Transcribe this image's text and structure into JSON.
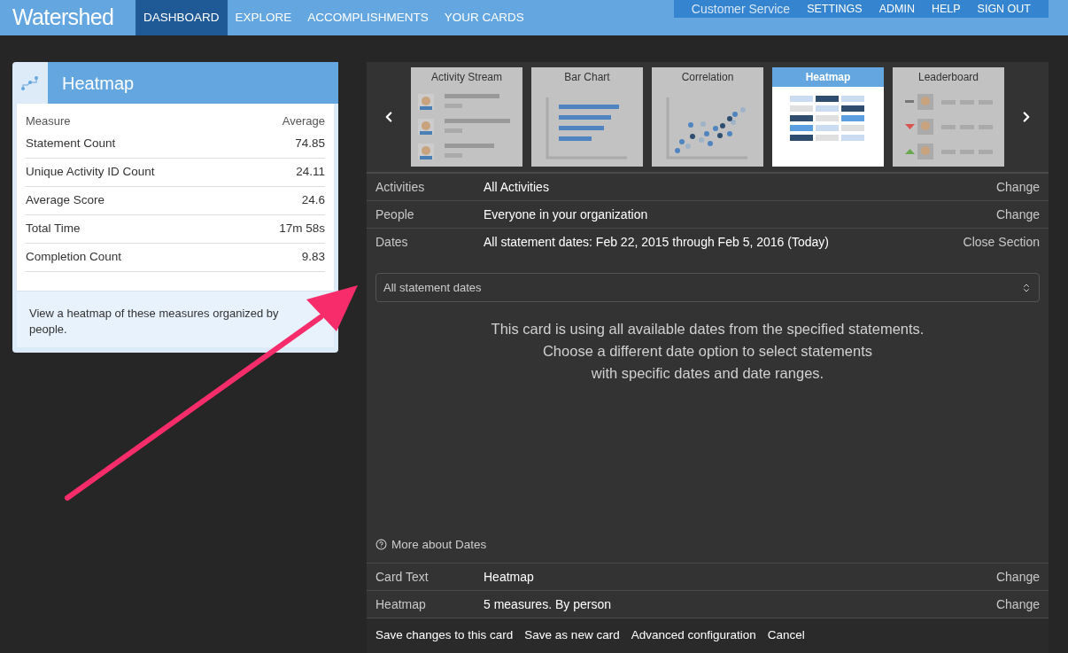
{
  "nav": {
    "logo": "Watershed",
    "items": [
      {
        "label": "DASHBOARD",
        "selected": true
      },
      {
        "label": "EXPLORE",
        "selected": false
      },
      {
        "label": "ACCOMPLISHMENTS",
        "selected": false
      },
      {
        "label": "YOUR CARDS",
        "selected": false
      }
    ],
    "account": "Customer Service",
    "links": [
      "SETTINGS",
      "ADMIN",
      "HELP",
      "SIGN OUT"
    ]
  },
  "card": {
    "title": "Heatmap",
    "columns": [
      "Measure",
      "Average"
    ],
    "rows": [
      {
        "measure": "Statement Count",
        "average": "74.85"
      },
      {
        "measure": "Unique Activity ID Count",
        "average": "24.11"
      },
      {
        "measure": "Average Score",
        "average": "24.6"
      },
      {
        "measure": "Total Time",
        "average": "17m 58s"
      },
      {
        "measure": "Completion Count",
        "average": "9.83"
      }
    ],
    "description": "View a heatmap of these measures organized by people."
  },
  "gallery": [
    {
      "label": "Activity Stream",
      "kind": "stream",
      "selected": false
    },
    {
      "label": "Bar Chart",
      "kind": "bar",
      "selected": false
    },
    {
      "label": "Correlation",
      "kind": "scatter",
      "selected": false
    },
    {
      "label": "Heatmap",
      "kind": "heatmap",
      "selected": true
    },
    {
      "label": "Leaderboard",
      "kind": "leaderboard",
      "selected": false
    }
  ],
  "settings": [
    {
      "label": "Activities",
      "value": "All Activities",
      "action": "Change"
    },
    {
      "label": "People",
      "value": "Everyone in your organization",
      "action": "Change"
    },
    {
      "label": "Dates",
      "value": "All statement dates: Feb 22, 2015 through Feb 5, 2016 (Today)",
      "action": "Close Section"
    }
  ],
  "dates": {
    "select": "All statement dates",
    "message": [
      "This card is using all available dates from the specified statements.",
      "Choose a different date option to select statements",
      "with specific dates and date ranges."
    ],
    "more": "More about Dates"
  },
  "settings_after": [
    {
      "label": "Card Text",
      "value": "Heatmap",
      "action": "Change"
    },
    {
      "label": "Heatmap",
      "value": "5 measures. By person",
      "action": "Change"
    }
  ],
  "footer": [
    "Save changes to this card",
    "Save as new card",
    "Advanced configuration",
    "Cancel"
  ]
}
